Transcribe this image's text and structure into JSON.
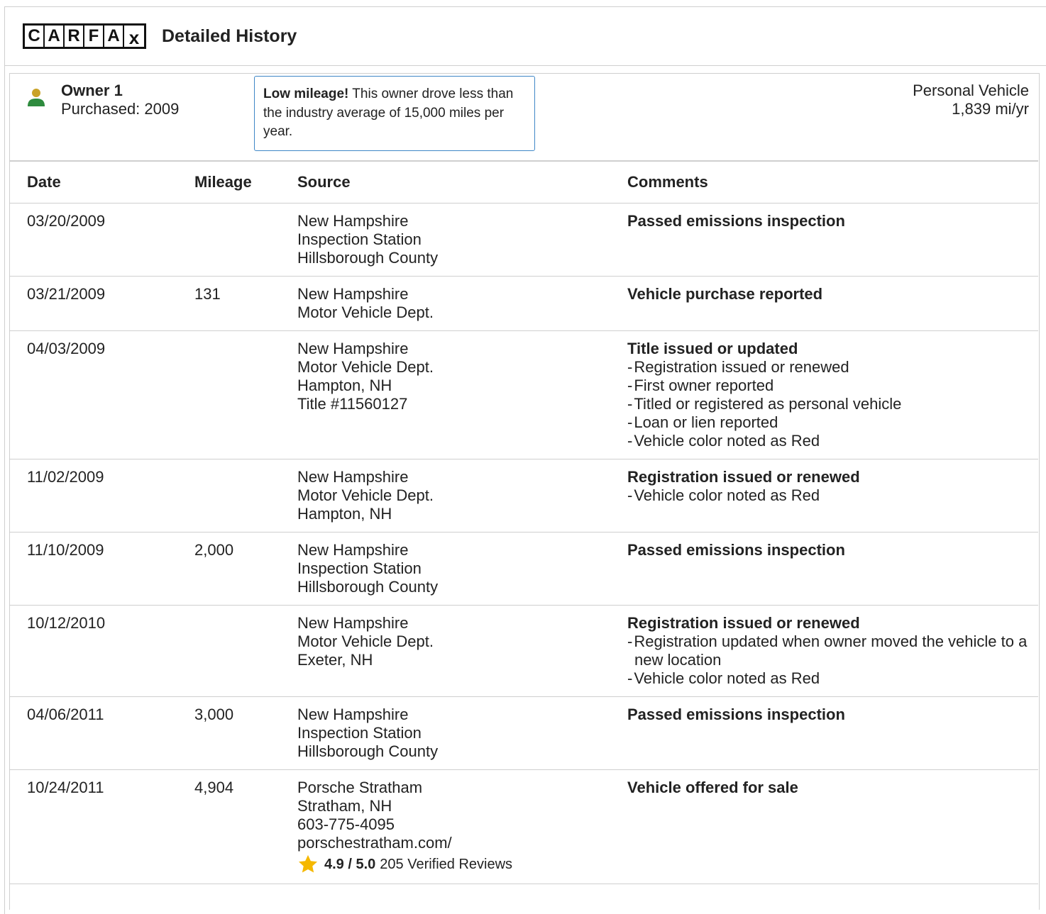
{
  "header": {
    "logo_letters": [
      "C",
      "A",
      "R",
      "F",
      "A"
    ],
    "logo_last": "x",
    "title": "Detailed History"
  },
  "owner": {
    "title": "Owner 1",
    "purchased": "Purchased: 2009",
    "note_bold": "Low mileage!",
    "note_text": " This owner drove less than the industry average of 15,000 miles per year.",
    "vehicle_type": "Personal Vehicle",
    "miles_per_year": "1,839 mi/yr"
  },
  "table": {
    "headers": [
      "Date",
      "Mileage",
      "Source",
      "Comments"
    ],
    "rows": [
      {
        "date": "03/20/2009",
        "mileage": "",
        "source": [
          "New Hampshire",
          "Inspection Station",
          "Hillsborough County"
        ],
        "comment_title": "Passed emissions inspection",
        "comment_items": []
      },
      {
        "date": "03/21/2009",
        "mileage": "131",
        "source": [
          "New Hampshire",
          "Motor Vehicle Dept."
        ],
        "comment_title": "Vehicle purchase reported",
        "comment_items": []
      },
      {
        "date": "04/03/2009",
        "mileage": "",
        "source": [
          "New Hampshire",
          "Motor Vehicle Dept.",
          "Hampton, NH",
          "Title #11560127"
        ],
        "comment_title": "Title issued or updated",
        "comment_items": [
          "Registration issued or renewed",
          "First owner reported",
          "Titled or registered as personal vehicle",
          "Loan or lien reported",
          "Vehicle color noted as Red"
        ]
      },
      {
        "date": "11/02/2009",
        "mileage": "",
        "source": [
          "New Hampshire",
          "Motor Vehicle Dept.",
          "Hampton, NH"
        ],
        "comment_title": "Registration issued or renewed",
        "comment_items": [
          "Vehicle color noted as Red"
        ]
      },
      {
        "date": "11/10/2009",
        "mileage": "2,000",
        "source": [
          "New Hampshire",
          "Inspection Station",
          "Hillsborough County"
        ],
        "comment_title": "Passed emissions inspection",
        "comment_items": []
      },
      {
        "date": "10/12/2010",
        "mileage": "",
        "source": [
          "New Hampshire",
          "Motor Vehicle Dept.",
          "Exeter, NH"
        ],
        "comment_title": "Registration issued or renewed",
        "comment_items": [
          "Registration updated when owner moved the vehicle to a new location",
          "Vehicle color noted as Red"
        ]
      },
      {
        "date": "04/06/2011",
        "mileage": "3,000",
        "source": [
          "New Hampshire",
          "Inspection Station",
          "Hillsborough County"
        ],
        "comment_title": "Passed emissions inspection",
        "comment_items": []
      },
      {
        "date": "10/24/2011",
        "mileage": "4,904",
        "source": [
          "Porsche Stratham",
          "Stratham, NH",
          "603-775-4095",
          "porschestratham.com/"
        ],
        "rating_score": "4.9 / 5.0",
        "rating_reviews": "205 Verified Reviews",
        "comment_title": "Vehicle offered for sale",
        "comment_items": []
      }
    ]
  },
  "colors": {
    "note_border": "#3f87c7",
    "person_head": "#c9a227",
    "person_body": "#2e8b3e",
    "star": "#f5b800"
  },
  "icons": {
    "owner": "person-icon",
    "rating": "star-icon"
  }
}
